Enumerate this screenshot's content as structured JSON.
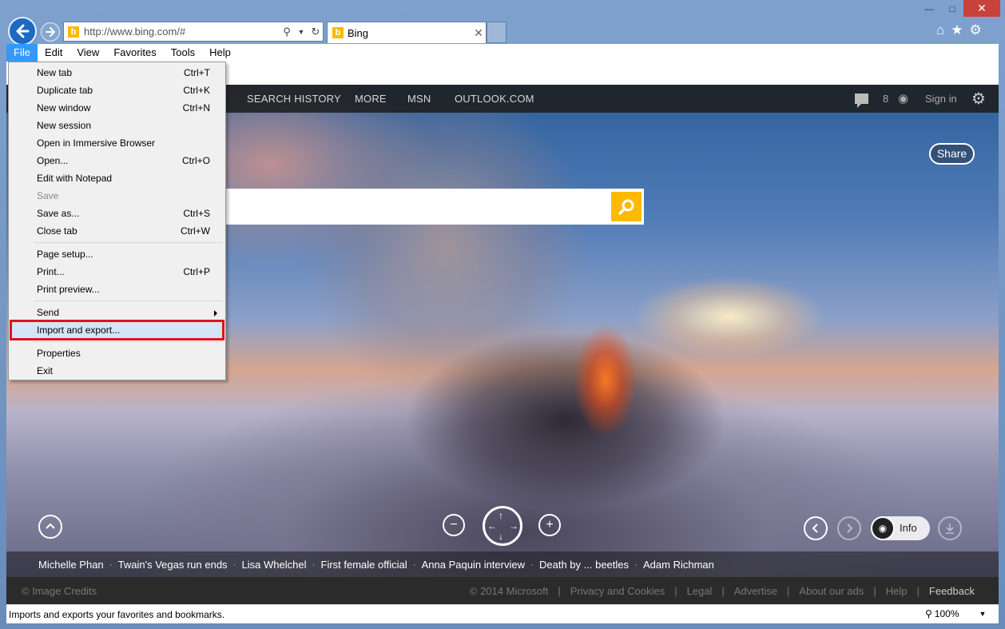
{
  "browser": {
    "address_url": "http://www.bing.com/#",
    "tab_title": "Bing",
    "menu": [
      "File",
      "Edit",
      "View",
      "Favorites",
      "Tools",
      "Help"
    ],
    "active_menu": "File",
    "status_text": "Imports and exports your favorites and bookmarks.",
    "zoom": "100%"
  },
  "file_menu": {
    "items": [
      {
        "label": "New tab",
        "shortcut": "Ctrl+T"
      },
      {
        "label": "Duplicate tab",
        "shortcut": "Ctrl+K"
      },
      {
        "label": "New window",
        "shortcut": "Ctrl+N"
      },
      {
        "label": "New session",
        "shortcut": ""
      },
      {
        "label": "Open in Immersive Browser",
        "shortcut": ""
      },
      {
        "label": "Open...",
        "shortcut": "Ctrl+O"
      },
      {
        "label": "Edit with Notepad",
        "shortcut": ""
      },
      {
        "label": "Save",
        "shortcut": "",
        "disabled": true
      },
      {
        "label": "Save as...",
        "shortcut": "Ctrl+S"
      },
      {
        "label": "Close tab",
        "shortcut": "Ctrl+W"
      },
      {
        "label": "Page setup...",
        "shortcut": ""
      },
      {
        "label": "Print...",
        "shortcut": "Ctrl+P"
      },
      {
        "label": "Print preview...",
        "shortcut": ""
      },
      {
        "label": "Send",
        "shortcut": "",
        "submenu": true
      },
      {
        "label": "Import and export...",
        "shortcut": "",
        "highlighted": true
      },
      {
        "label": "Properties",
        "shortcut": ""
      },
      {
        "label": "Exit",
        "shortcut": ""
      }
    ]
  },
  "bing": {
    "nav": [
      "SEARCH HISTORY",
      "MORE",
      "MSN",
      "OUTLOOK.COM"
    ],
    "rewards_count": "8",
    "sign_in": "Sign in",
    "share": "Share",
    "info": "Info",
    "news": [
      "Michelle Phan",
      "Twain's Vegas run ends",
      "Lisa Whelchel",
      "First female official",
      "Anna Paquin interview",
      "Death by ... beetles",
      "Adam Richman"
    ],
    "footer": {
      "credits": "© Image Credits",
      "links": [
        "© 2014 Microsoft",
        "Privacy and Cookies",
        "Legal",
        "Advertise",
        "About our ads",
        "Help"
      ],
      "feedback": "Feedback"
    }
  },
  "colors": {
    "highlight_border": "#e0131b",
    "menu_highlight": "#d3e5f6",
    "bing_yellow": "#ffb900",
    "menu_active": "#3399ff"
  }
}
